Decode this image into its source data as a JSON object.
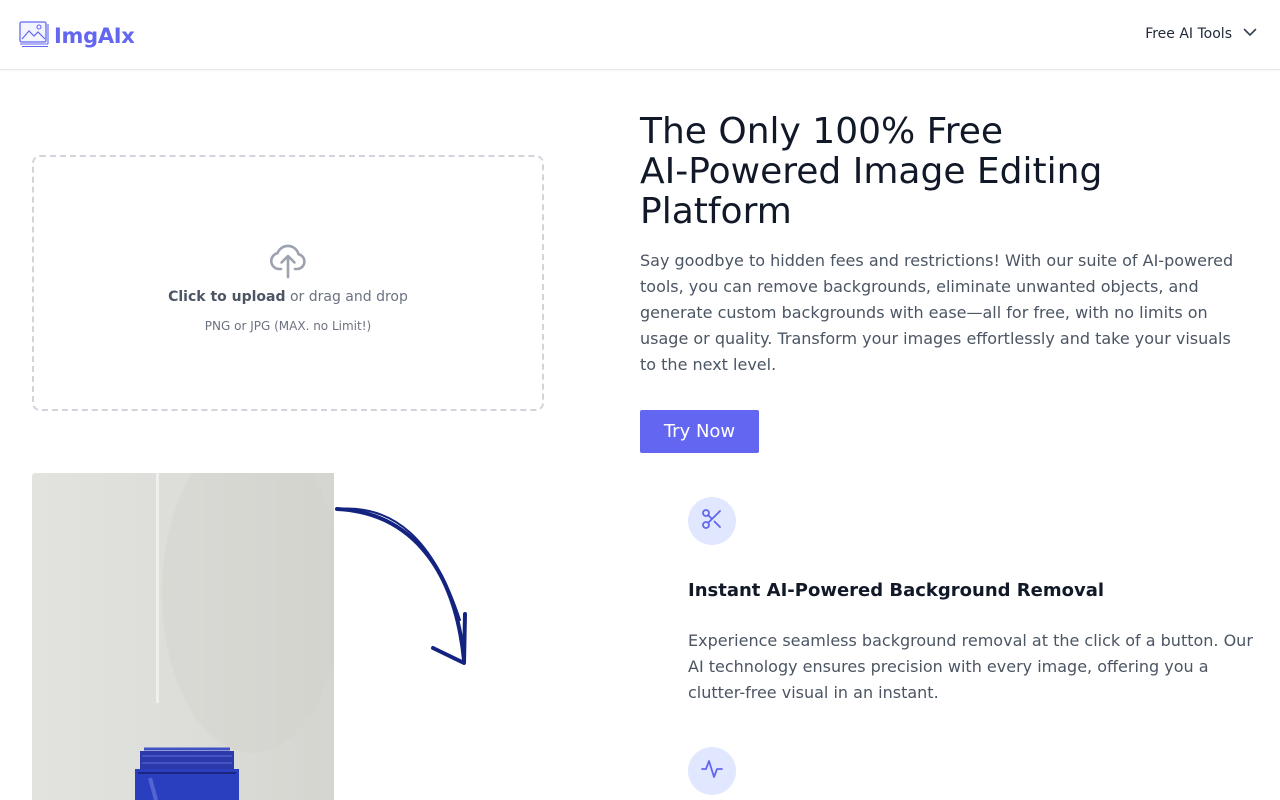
{
  "header": {
    "logo_text": "ImgAIx",
    "menu_label": "Free AI Tools"
  },
  "upload": {
    "click_label": "Click to upload",
    "drag_label": " or drag and drop",
    "formats": "PNG or JPG (MAX. no Limit!)"
  },
  "hero": {
    "title_line1": "The Only 100% Free",
    "title_line2": "AI-Powered Image Editing",
    "title_line3": "Platform",
    "description": "Say goodbye to hidden fees and restrictions! With our suite of AI-powered tools, you can remove backgrounds, eliminate unwanted objects, and generate custom backgrounds with ease—all for free, with no limits on usage or quality. Transform your images effortlessly and take your visuals to the next level.",
    "cta_label": "Try Now"
  },
  "features": [
    {
      "icon": "scissors-icon",
      "title": "Instant AI-Powered Background Removal",
      "description": "Experience seamless background removal at the click of a button. Our AI technology ensures precision with every image, offering you a clutter-free visual in an instant."
    },
    {
      "icon": "activity-icon"
    }
  ],
  "colors": {
    "accent": "#6366f1",
    "icon_bg": "#e0e7ff",
    "arrow": "#13237f"
  }
}
